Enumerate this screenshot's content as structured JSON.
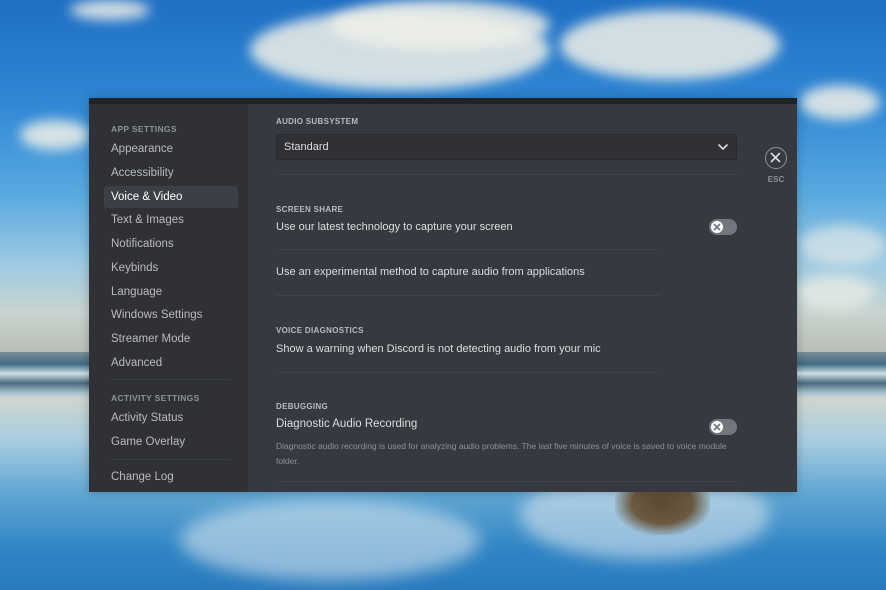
{
  "sidebar": {
    "app_settings_header": "App Settings",
    "app_items": [
      {
        "label": "Appearance"
      },
      {
        "label": "Accessibility"
      },
      {
        "label": "Voice & Video",
        "selected": true
      },
      {
        "label": "Text & Images"
      },
      {
        "label": "Notifications"
      },
      {
        "label": "Keybinds"
      },
      {
        "label": "Language"
      },
      {
        "label": "Windows Settings"
      },
      {
        "label": "Streamer Mode"
      },
      {
        "label": "Advanced"
      }
    ],
    "activity_settings_header": "Activity Settings",
    "activity_items": [
      {
        "label": "Activity Status"
      },
      {
        "label": "Game Overlay"
      }
    ],
    "change_log": "Change Log"
  },
  "content": {
    "audio_subsystem": {
      "label": "Audio Subsystem",
      "selected_value": "Standard"
    },
    "screen_share": {
      "label": "Screen Share",
      "latest_tech": {
        "title": "Use our latest technology to capture your screen",
        "enabled": false
      },
      "experimental_audio": {
        "title": "Use an experimental method to capture audio from applications"
      }
    },
    "voice_diagnostics": {
      "label": "Voice Diagnostics",
      "warning": {
        "title": "Show a warning when Discord is not detecting audio from your mic"
      }
    },
    "debugging": {
      "label": "Debugging",
      "diagnostic_recording": {
        "title": "Diagnostic Audio Recording",
        "description": "Diagnostic audio recording is used for analyzing audio problems. The last five minutes of voice is saved to voice module folder.",
        "enabled": false
      }
    }
  },
  "close": {
    "label": "ESC"
  },
  "colors": {
    "window_bg": "#36393f",
    "sidebar_bg": "#2f3136",
    "selected_item_bg": "#3c3f45",
    "toggle_off": "#72767d"
  }
}
